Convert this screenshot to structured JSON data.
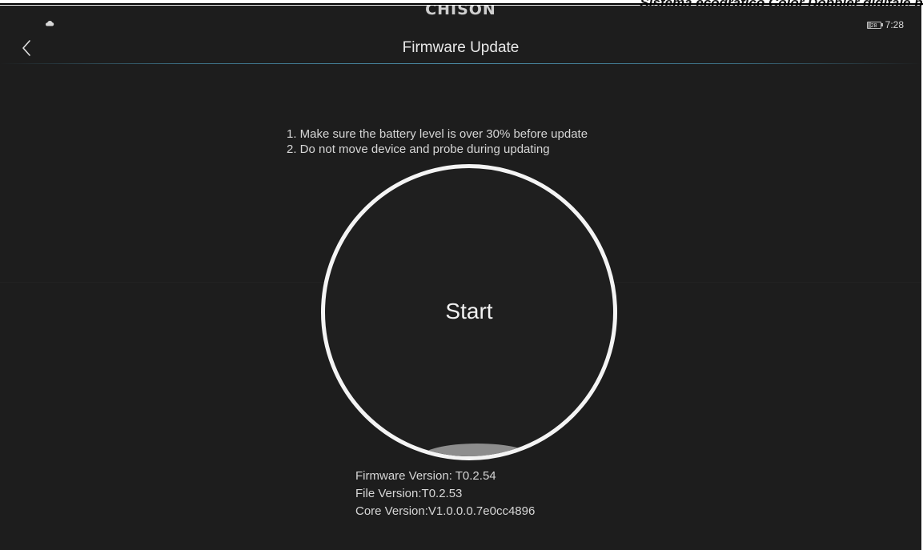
{
  "document": {
    "header_text": "Sistema ecografico Color Doppler digitale po"
  },
  "status_bar": {
    "brand": "CHISON",
    "battery_level": "28",
    "time": "7:28",
    "cloud_icon": "cloud-icon"
  },
  "header": {
    "title": "Firmware Update",
    "back_icon": "chevron-left-icon"
  },
  "instructions": {
    "line1": "1. Make sure the battery level is over 30% before update",
    "line2": "2. Do not move device and probe during updating"
  },
  "start_button": {
    "label": "Start"
  },
  "versions": {
    "firmware": "Firmware Version: T0.2.54",
    "file": "File Version:T0.2.53",
    "core": "Core Version:V1.0.0.0.7e0cc4896"
  },
  "colors": {
    "background": "#1d1d1d",
    "circle": "#f4f4f4",
    "accent_line": "#4b8ca7",
    "text": "#d6d6d6"
  }
}
